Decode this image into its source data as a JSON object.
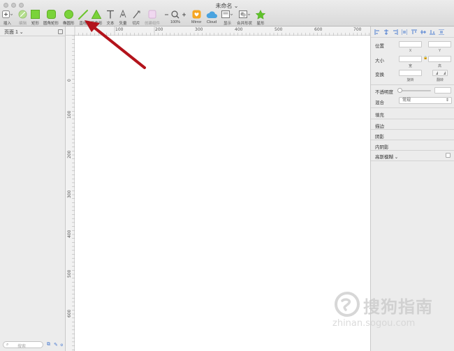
{
  "window": {
    "title": "未命名"
  },
  "toolbar": {
    "insert": "插入",
    "edit": "编辑",
    "rectangle": "矩形",
    "rounded_rectangle": "圆角矩形",
    "oval": "椭圆形",
    "line": "直线",
    "triangle": "三角形",
    "text": "文本",
    "vector": "矢量",
    "slice": "切片",
    "create_symbol": "创建组件",
    "zoom_level": "100%",
    "mirror": "Mirror",
    "cloud": "Cloud",
    "display": "显示",
    "combine_shapes": "合并形状",
    "star": "星形"
  },
  "left_panel": {
    "page_selector": "页面 1",
    "search_placeholder": "搜索"
  },
  "rulers": {
    "horizontal": [
      "100",
      "200",
      "300",
      "400",
      "500",
      "600",
      "700"
    ],
    "vertical": [
      "0",
      "100",
      "200",
      "300",
      "400",
      "500",
      "600"
    ]
  },
  "inspector": {
    "position": "位置",
    "x": "X",
    "y": "Y",
    "size": "大小",
    "width": "宽",
    "height": "高",
    "transform": "变换",
    "rotate": "旋转",
    "flip": "翻转",
    "opacity": "不透明度",
    "blending": "混合",
    "blending_value": "常规",
    "fill": "填充",
    "border": "描边",
    "shadow": "阴影",
    "inner_shadow": "内阴影",
    "gaussian_blur": "高斯模糊"
  },
  "watermark": {
    "brand": "搜狗指南",
    "url": "zhinan.sogou.com"
  },
  "colors": {
    "shape_green": "#7ad33a",
    "annotation_red": "#b3131b",
    "accent_blue": "#4a7bd1"
  }
}
